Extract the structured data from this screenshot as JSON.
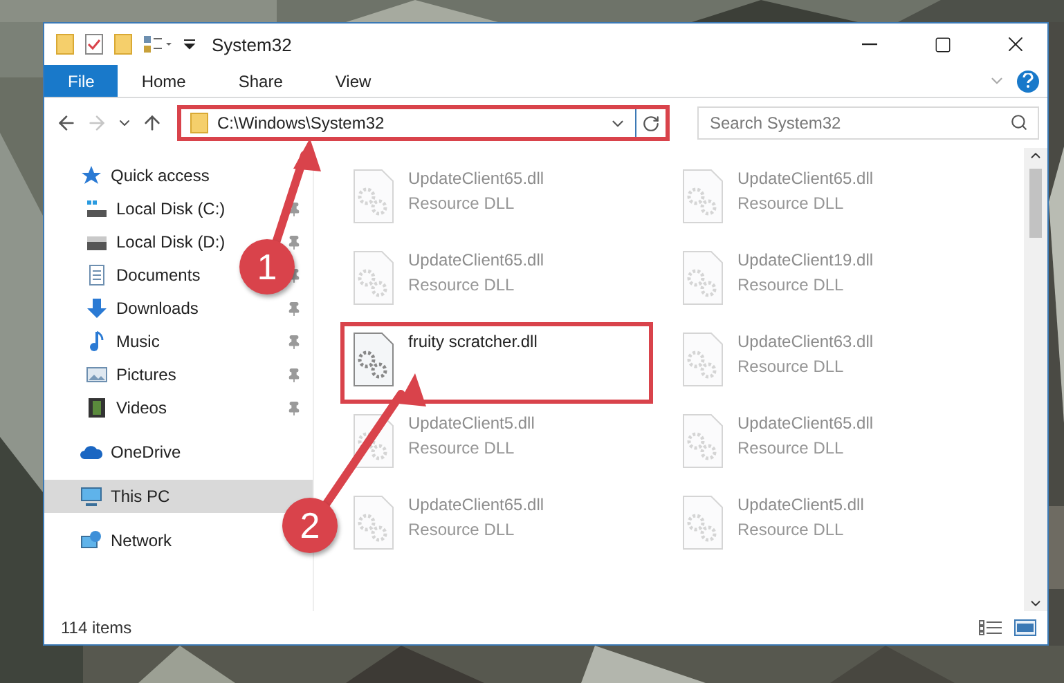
{
  "window": {
    "title": "System32"
  },
  "ribbon": {
    "tabs": [
      {
        "label": "File",
        "kind": "file-menu",
        "selected": false
      },
      {
        "label": "Home",
        "kind": "tab",
        "selected": false
      },
      {
        "label": "Share",
        "kind": "tab",
        "selected": false
      },
      {
        "label": "View",
        "kind": "tab",
        "selected": false
      }
    ]
  },
  "address_bar": {
    "path": "C:\\Windows\\System32",
    "highlighted": true
  },
  "search": {
    "placeholder": "Search System32"
  },
  "sidebar": {
    "items": [
      {
        "label": "Quick access",
        "selected": false,
        "children": [
          {
            "label": "Local Disk (C:)",
            "pinned": true,
            "selected": false
          },
          {
            "label": "Local Disk (D:)",
            "pinned": true,
            "selected": false
          },
          {
            "label": "Documents",
            "pinned": true,
            "selected": false
          },
          {
            "label": "Downloads",
            "pinned": true,
            "selected": false
          },
          {
            "label": "Music",
            "pinned": true,
            "selected": false
          },
          {
            "label": "Pictures",
            "pinned": true,
            "selected": false
          },
          {
            "label": "Videos",
            "pinned": true,
            "selected": false
          }
        ]
      },
      {
        "label": "OneDrive",
        "selected": false
      },
      {
        "label": "This PC",
        "selected": true
      },
      {
        "label": "Network",
        "selected": false
      }
    ]
  },
  "files": [
    {
      "name": "UpdateClient65.dll",
      "type": "Resource DLL",
      "faded": true,
      "highlighted": false
    },
    {
      "name": "UpdateClient65.dll",
      "type": "Resource DLL",
      "faded": true,
      "highlighted": false
    },
    {
      "name": "UpdateClient65.dll",
      "type": "Resource DLL",
      "faded": true,
      "highlighted": false
    },
    {
      "name": "UpdateClient19.dll",
      "type": "Resource DLL",
      "faded": true,
      "highlighted": false
    },
    {
      "name": "fruity scratcher.dll",
      "faded": false,
      "highlighted": true
    },
    {
      "name": "UpdateClient63.dll",
      "type": "Resource DLL",
      "faded": true,
      "highlighted": false
    },
    {
      "name": "UpdateClient5.dll",
      "type": "Resource DLL",
      "faded": true,
      "highlighted": false
    },
    {
      "name": "UpdateClient65.dll",
      "type": "Resource DLL",
      "faded": true,
      "highlighted": false
    },
    {
      "name": "UpdateClient65.dll",
      "type": "Resource DLL",
      "faded": true,
      "highlighted": false
    },
    {
      "name": "UpdateClient5.dll",
      "type": "Resource DLL",
      "faded": true,
      "highlighted": false
    }
  ],
  "status_bar": {
    "item_count": "114 items"
  },
  "callouts": [
    {
      "number": "1"
    },
    {
      "number": "2"
    }
  ]
}
